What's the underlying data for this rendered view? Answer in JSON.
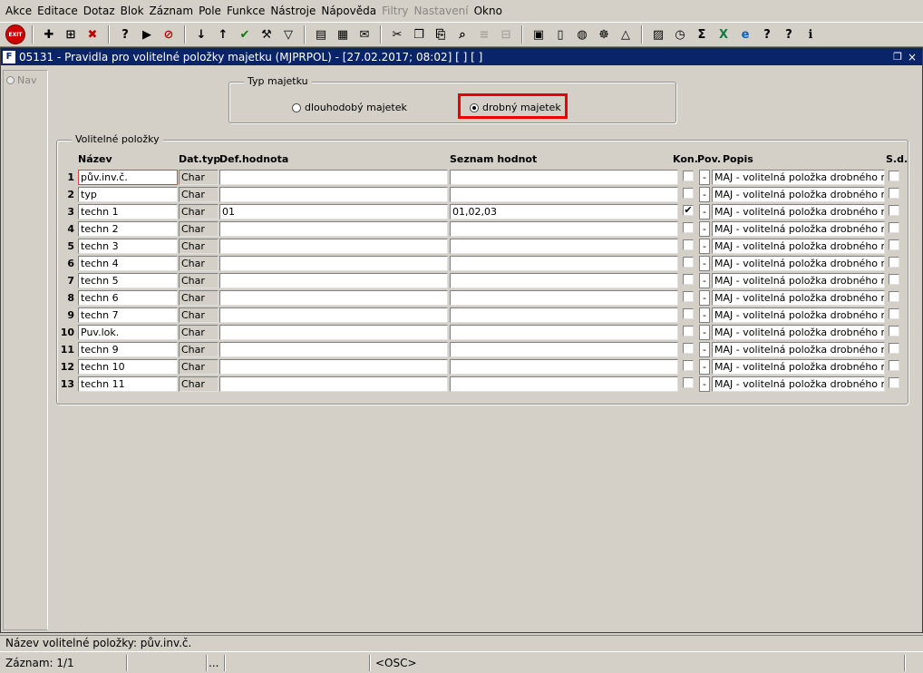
{
  "menu": [
    "Akce",
    "Editace",
    "Dotaz",
    "Blok",
    "Záznam",
    "Pole",
    "Funkce",
    "Nástroje",
    "Nápověda",
    "Filtry",
    "Nastavení",
    "Okno"
  ],
  "menu_disabled": [
    "Filtry",
    "Nastavení"
  ],
  "toolbar": {
    "exit_label": "EXIT",
    "icons": [
      "add-record-icon",
      "insert-record-icon",
      "delete-record-icon",
      "query-icon",
      "query-execute-icon",
      "query-cancel-icon",
      "sort-asc-icon",
      "sort-desc-icon",
      "confirm-icon",
      "wrench-icon",
      "filter-icon",
      "print-icon",
      "printer-setup-icon",
      "mail-icon",
      "cut-icon",
      "copy-icon",
      "paste-icon",
      "search-icon",
      "list-disabled-icon",
      "grid-disabled-icon",
      "clipboard-icon",
      "document-icon",
      "globe-icon",
      "helm-icon",
      "mountain-icon",
      "chart-icon",
      "clock-icon",
      "sigma-icon",
      "excel-icon",
      "ie-icon",
      "help-icon",
      "help-question-icon",
      "info-icon"
    ]
  },
  "window": {
    "title": "05131 - Pravidla pro volitelné položky majetku (MJPRPOL) - [27.02.2017; 08:02]  [ ]  [ ]",
    "logo": "F"
  },
  "nav": {
    "label": "Nav"
  },
  "typ_majetku": {
    "caption": "Typ majetku",
    "options": [
      "dlouhodobý majetek",
      "drobný majetek"
    ],
    "selected": "drobný majetek"
  },
  "volitelne": {
    "caption": "Volitelné položky",
    "headers": {
      "nazev": "Název",
      "dattyp": "Dat.typ",
      "defhodnota": "Def.hodnota",
      "seznam": "Seznam hodnot",
      "kon": "Kon.",
      "pov": "Pov.",
      "popis": "Popis",
      "sd": "S.d."
    },
    "rows": [
      {
        "num": "1",
        "nazev": "pův.inv.č.",
        "typ": "Char",
        "def": "",
        "seznam": "",
        "kon": false,
        "pov": "-",
        "popis": "MAJ - volitelná položka drobného majetku",
        "sd": false
      },
      {
        "num": "2",
        "nazev": "typ",
        "typ": "Char",
        "def": "",
        "seznam": "",
        "kon": false,
        "pov": "-",
        "popis": "MAJ - volitelná položka drobného majetku",
        "sd": false
      },
      {
        "num": "3",
        "nazev": "techn 1",
        "typ": "Char",
        "def": "01",
        "seznam": "01,02,03",
        "kon": true,
        "pov": "-",
        "popis": "MAJ - volitelná položka drobného majetku",
        "sd": false
      },
      {
        "num": "4",
        "nazev": "techn 2",
        "typ": "Char",
        "def": "",
        "seznam": "",
        "kon": false,
        "pov": "-",
        "popis": "MAJ - volitelná položka drobného majetku",
        "sd": false
      },
      {
        "num": "5",
        "nazev": "techn 3",
        "typ": "Char",
        "def": "",
        "seznam": "",
        "kon": false,
        "pov": "-",
        "popis": "MAJ - volitelná položka drobného majetku",
        "sd": false
      },
      {
        "num": "6",
        "nazev": "techn 4",
        "typ": "Char",
        "def": "",
        "seznam": "",
        "kon": false,
        "pov": "-",
        "popis": "MAJ - volitelná položka drobného majetku",
        "sd": false
      },
      {
        "num": "7",
        "nazev": "techn 5",
        "typ": "Char",
        "def": "",
        "seznam": "",
        "kon": false,
        "pov": "-",
        "popis": "MAJ - volitelná položka drobného majetku",
        "sd": false
      },
      {
        "num": "8",
        "nazev": "techn 6",
        "typ": "Char",
        "def": "",
        "seznam": "",
        "kon": false,
        "pov": "-",
        "popis": "MAJ - volitelná položka drobného majetku",
        "sd": false
      },
      {
        "num": "9",
        "nazev": "techn 7",
        "typ": "Char",
        "def": "",
        "seznam": "",
        "kon": false,
        "pov": "-",
        "popis": "MAJ - volitelná položka drobného majetku",
        "sd": false
      },
      {
        "num": "10",
        "nazev": "Puv.lok.",
        "typ": "Char",
        "def": "",
        "seznam": "",
        "kon": false,
        "pov": "-",
        "popis": "MAJ - volitelná položka drobného majetku",
        "sd": false
      },
      {
        "num": "11",
        "nazev": "techn 9",
        "typ": "Char",
        "def": "",
        "seznam": "",
        "kon": false,
        "pov": "-",
        "popis": "MAJ - volitelná položka drobného majetku",
        "sd": false
      },
      {
        "num": "12",
        "nazev": "techn 10",
        "typ": "Char",
        "def": "",
        "seznam": "",
        "kon": false,
        "pov": "-",
        "popis": "MAJ - volitelná položka drobného majetku",
        "sd": false
      },
      {
        "num": "13",
        "nazev": "techn 11",
        "typ": "Char",
        "def": "",
        "seznam": "",
        "kon": false,
        "pov": "-",
        "popis": "MAJ - volitelná položka drobného majetku",
        "sd": false
      }
    ]
  },
  "status": {
    "message": "Název volitelné položky: pův.inv.č.",
    "record": "Záznam: 1/1",
    "seg3": "...",
    "osc": "<OSC>"
  },
  "colors": {
    "titlebar": "#0a246a",
    "highlight": "#ee0000",
    "window_bg": "#d4d0c8"
  }
}
